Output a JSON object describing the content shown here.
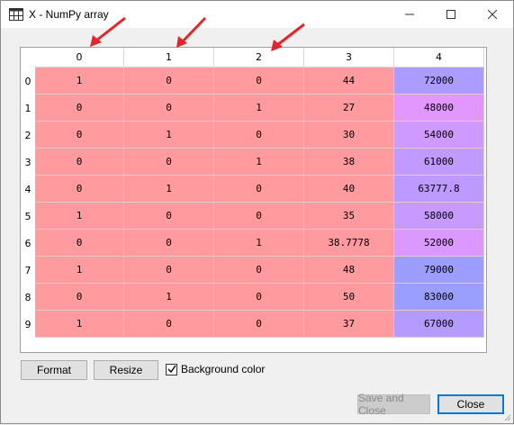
{
  "window": {
    "title": "X - NumPy array",
    "icon": "grid-icon",
    "controls": [
      "minimize-icon",
      "maximize-icon",
      "close-icon"
    ]
  },
  "table": {
    "columns": [
      "0",
      "1",
      "2",
      "3",
      "4"
    ],
    "rows": [
      {
        "label": "0",
        "cells": [
          "1",
          "0",
          "0",
          "44",
          "72000"
        ]
      },
      {
        "label": "1",
        "cells": [
          "0",
          "0",
          "1",
          "27",
          "48000"
        ]
      },
      {
        "label": "2",
        "cells": [
          "0",
          "1",
          "0",
          "30",
          "54000"
        ]
      },
      {
        "label": "3",
        "cells": [
          "0",
          "0",
          "1",
          "38",
          "61000"
        ]
      },
      {
        "label": "4",
        "cells": [
          "0",
          "1",
          "0",
          "40",
          "63777.8"
        ]
      },
      {
        "label": "5",
        "cells": [
          "1",
          "0",
          "0",
          "35",
          "58000"
        ]
      },
      {
        "label": "6",
        "cells": [
          "0",
          "0",
          "1",
          "38.7778",
          "52000"
        ]
      },
      {
        "label": "7",
        "cells": [
          "1",
          "0",
          "0",
          "48",
          "79000"
        ]
      },
      {
        "label": "8",
        "cells": [
          "0",
          "1",
          "0",
          "50",
          "83000"
        ]
      },
      {
        "label": "9",
        "cells": [
          "1",
          "0",
          "0",
          "37",
          "67000"
        ]
      }
    ],
    "colors": {
      "low": "#ff9a9e",
      "col4": [
        "#ad9cff",
        "#e296ff",
        "#cf9aff",
        "#c09aff",
        "#bd9aff",
        "#c69aff",
        "#db98ff",
        "#9d9dff",
        "#9a9eff",
        "#b49bff"
      ]
    },
    "annotations": {
      "arrow_color": "#e3262b",
      "arrowed_columns": [
        "0",
        "1",
        "2"
      ]
    }
  },
  "footer": {
    "format_label": "Format",
    "resize_label": "Resize",
    "background_color_label": "Background color",
    "background_color_checked": true,
    "save_close_label": "Save and Close",
    "close_label": "Close"
  }
}
